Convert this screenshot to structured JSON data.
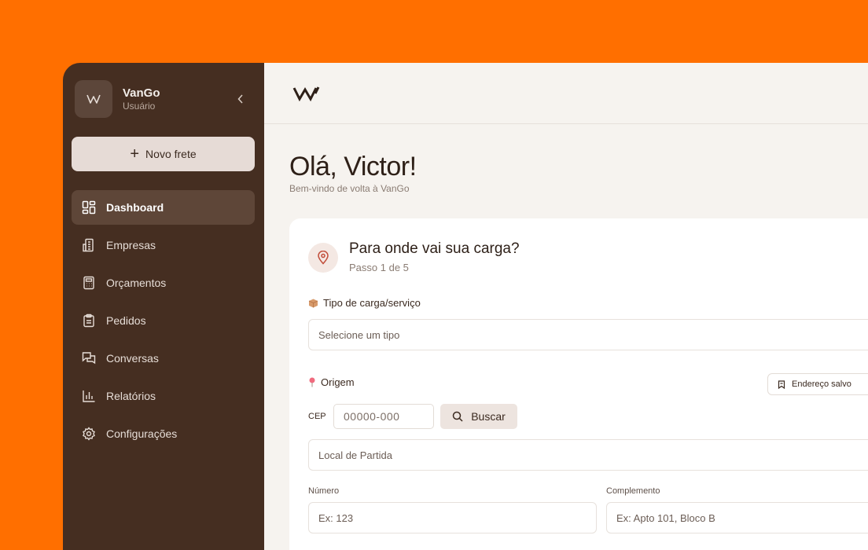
{
  "brand": {
    "name": "VanGo",
    "role": "Usuário"
  },
  "sidebar": {
    "new_button_label": "Novo frete",
    "items": [
      {
        "label": "Dashboard",
        "icon": "dashboard-icon",
        "active": true
      },
      {
        "label": "Empresas",
        "icon": "building-icon"
      },
      {
        "label": "Orçamentos",
        "icon": "calculator-icon"
      },
      {
        "label": "Pedidos",
        "icon": "clipboard-icon"
      },
      {
        "label": "Conversas",
        "icon": "chat-icon"
      },
      {
        "label": "Relatórios",
        "icon": "bar-chart-icon"
      },
      {
        "label": "Configurações",
        "icon": "gear-icon"
      }
    ]
  },
  "header": {
    "greeting": "Olá, Victor!",
    "subtitle": "Bem-vindo de volta à VanGo"
  },
  "form": {
    "title": "Para onde vai sua carga?",
    "step": "Passo 1 de 5",
    "cargo_type": {
      "label": "Tipo de carga/serviço",
      "placeholder": "Selecione um tipo"
    },
    "origin": {
      "label": "Origem",
      "saved_address_label": "Endereço salvo",
      "cep_label": "CEP",
      "cep_placeholder": "00000-000",
      "search_label": "Buscar",
      "departure_placeholder": "Local de Partida",
      "number_label": "Número",
      "number_placeholder": "Ex: 123",
      "complement_label": "Complemento",
      "complement_placeholder": "Ex: Apto 101, Bloco B"
    }
  },
  "colors": {
    "background": "#FF6F00",
    "sidebar": "#452E21",
    "main": "#F6F3EF",
    "accent": "#E6DBD6"
  }
}
